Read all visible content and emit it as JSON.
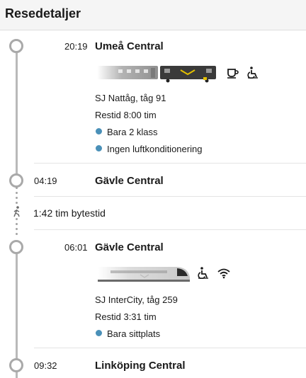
{
  "header": {
    "title": "Resedetaljer"
  },
  "segments": [
    {
      "departure_time": "20:19",
      "departure_station": "Umeå Central",
      "train_name": "SJ Nattåg, tåg 91",
      "travel_time": "Restid 8:00 tim",
      "notices": [
        "Bara 2 klass",
        "Ingen luftkonditionering"
      ],
      "amenities": [
        "coffee-cup-icon",
        "wheelchair-icon"
      ]
    },
    {
      "arrival_time": "04:19",
      "arrival_station": "Gävle Central"
    },
    {
      "transfer_text": "1:42 tim bytestid"
    },
    {
      "departure_time": "06:01",
      "departure_station": "Gävle Central",
      "train_name": "SJ InterCity, tåg 259",
      "travel_time": "Restid 3:31 tim",
      "notices": [
        "Bara sittplats"
      ],
      "amenities": [
        "wheelchair-icon",
        "wifi-icon"
      ]
    },
    {
      "arrival_time": "09:32",
      "arrival_station": "Linköping Central"
    }
  ],
  "colors": {
    "bullet": "#4a90b8",
    "timeline": "#b9b9b9",
    "header_bg": "#f5f5f5"
  }
}
